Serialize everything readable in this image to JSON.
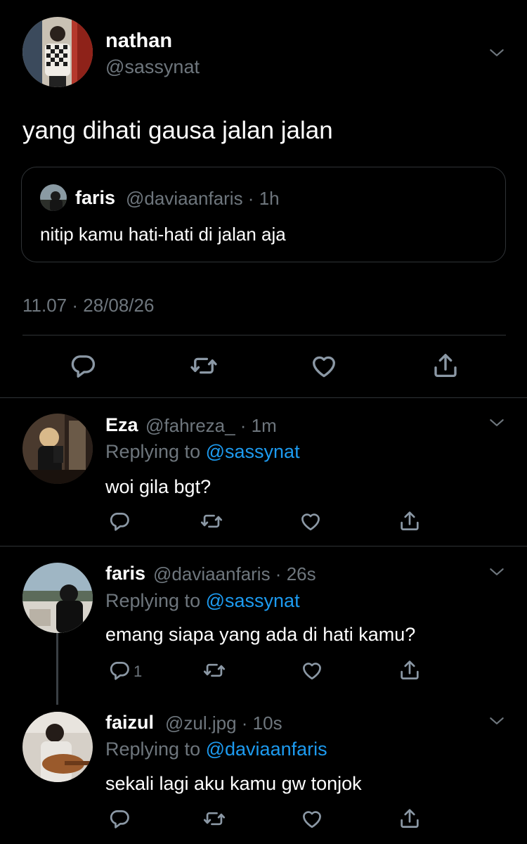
{
  "main_tweet": {
    "name": "nathan",
    "handle": "@sassynat",
    "text": "yang dihati gausa jalan jalan",
    "quote": {
      "name": "faris",
      "handle_time": "@daviaanfaris · 1h",
      "text": "nitip kamu hati-hati di jalan aja"
    },
    "timestamp": "11.07 · 28/08/26"
  },
  "replies": [
    {
      "name": "Eza",
      "handle_time": "@fahreza_ · 1m",
      "replying_prefix": "Replying to",
      "replying_to": "@sassynat",
      "text": "woi gila bgt?",
      "reply_count": ""
    },
    {
      "name": "faris",
      "handle_time": "@daviaanfaris · 26s",
      "replying_prefix": "Replying to",
      "replying_to": "@sassynat",
      "text": "emang siapa yang ada di hati kamu?",
      "reply_count": "1"
    },
    {
      "name": "faizul",
      "handle_time": "@zul.jpg · 10s",
      "replying_prefix": "Replying to",
      "replying_to": "@daviaanfaris",
      "text": "sekali lagi aku kamu gw tonjok",
      "reply_count": ""
    }
  ],
  "icons": {
    "reply": "reply-icon",
    "retweet": "retweet-icon",
    "like": "heart-icon",
    "share": "share-icon",
    "more": "chevron-down-icon"
  },
  "colors": {
    "background": "#000000",
    "text": "#ffffff",
    "muted": "#6e767d",
    "link": "#1d9bf0"
  }
}
